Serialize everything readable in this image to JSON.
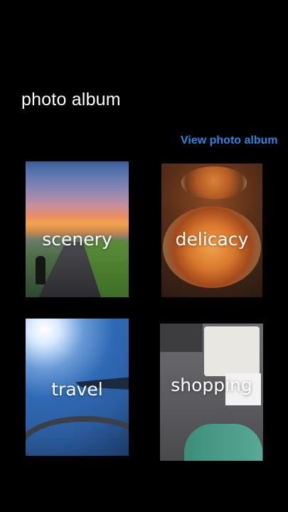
{
  "page": {
    "title": "photo album",
    "view_link": "View photo album"
  },
  "colors": {
    "background": "#000000",
    "title_text": "#ffffff",
    "link": "#2a86e0"
  },
  "albums": [
    {
      "label": "scenery"
    },
    {
      "label": "delicacy"
    },
    {
      "label": "travel"
    },
    {
      "label": "shopping"
    }
  ]
}
